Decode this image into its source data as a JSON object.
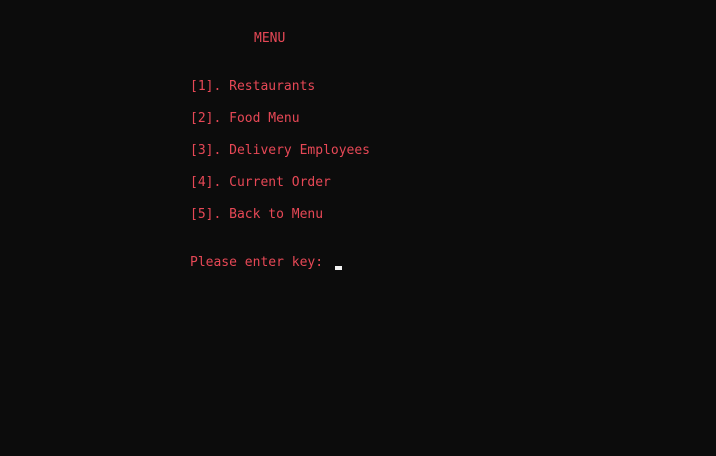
{
  "console": {
    "title": "MENU",
    "menu_items": [
      {
        "label": "[1]. Restaurants"
      },
      {
        "label": "[2]. Food Menu"
      },
      {
        "label": "[3]. Delivery Employees"
      },
      {
        "label": "[4]. Current Order"
      },
      {
        "label": "[5]. Back to Menu"
      }
    ],
    "prompt": "Please enter key:"
  },
  "colors": {
    "background": "#0c0c0c",
    "text": "#e74856",
    "cursor": "#f2f2f2"
  }
}
